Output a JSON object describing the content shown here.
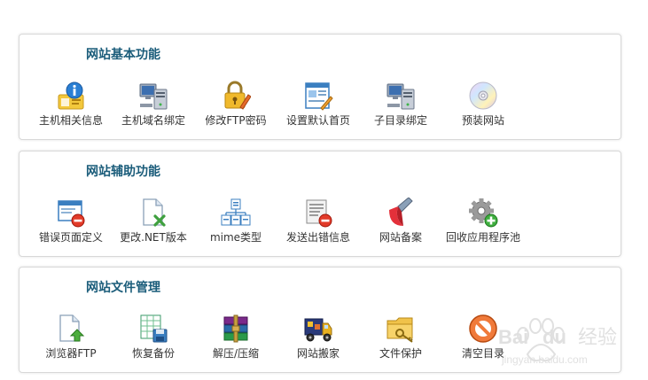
{
  "sections": [
    {
      "title": "网站基本功能",
      "items": [
        {
          "label": "主机相关信息",
          "icon": "info-icon"
        },
        {
          "label": "主机域名绑定",
          "icon": "computer-network-icon"
        },
        {
          "label": "修改FTP密码",
          "icon": "lock-edit-icon"
        },
        {
          "label": "设置默认首页",
          "icon": "webpage-edit-icon"
        },
        {
          "label": "子目录绑定",
          "icon": "computer-network-icon"
        },
        {
          "label": "预装网站",
          "icon": "cd-disc-icon"
        }
      ]
    },
    {
      "title": "网站辅助功能",
      "items": [
        {
          "label": "错误页面定义",
          "icon": "window-error-icon"
        },
        {
          "label": "更改.NET版本",
          "icon": "file-close-icon"
        },
        {
          "label": "mime类型",
          "icon": "file-tree-icon"
        },
        {
          "label": "发送出错信息",
          "icon": "document-error-icon"
        },
        {
          "label": "网站备案",
          "icon": "record-icon"
        },
        {
          "label": "回收应用程序池",
          "icon": "gear-add-icon"
        }
      ]
    },
    {
      "title": "网站文件管理",
      "items": [
        {
          "label": "浏览器FTP",
          "icon": "file-upload-icon"
        },
        {
          "label": "恢复备份",
          "icon": "backup-disk-icon"
        },
        {
          "label": "解压/压缩",
          "icon": "archive-books-icon"
        },
        {
          "label": "网站搬家",
          "icon": "moving-truck-icon"
        },
        {
          "label": "文件保护",
          "icon": "folder-key-icon"
        },
        {
          "label": "清空目录",
          "icon": "no-entry-icon"
        }
      ]
    }
  ],
  "watermark": {
    "brand": "Bai",
    "brand2": "du",
    "suffix": "经验",
    "url": "jingyan.baidu.com"
  }
}
